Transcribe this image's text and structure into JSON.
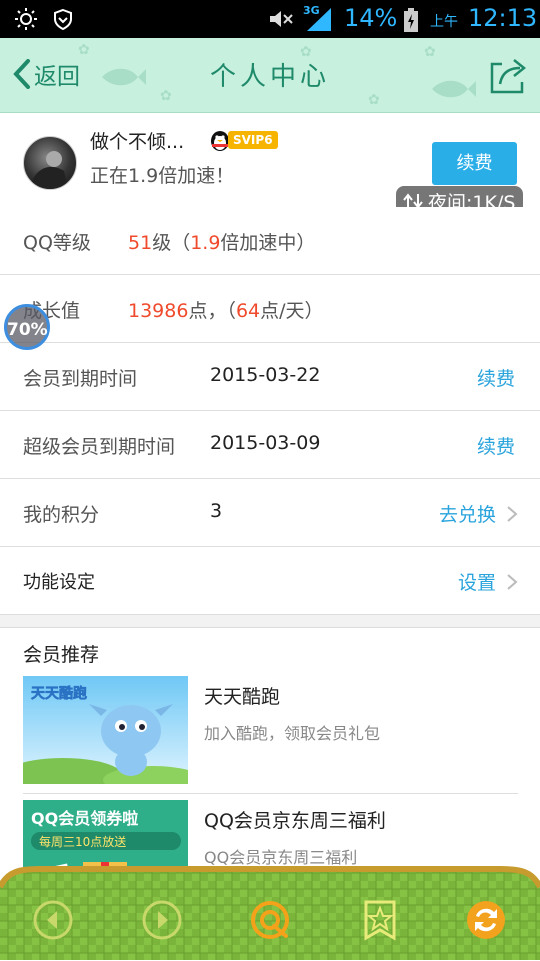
{
  "status_bar": {
    "network": "3G",
    "battery": "14%",
    "ampm": "上午",
    "time": "12:13"
  },
  "header": {
    "back_label": "返回",
    "title": "个人中心"
  },
  "profile": {
    "nickname": "做个不倾...",
    "vip_badge": "SVIP6",
    "speed_text": "正在1.9倍加速！",
    "renew_label": "续费",
    "speed_float": "夜间:1K/S"
  },
  "rows": [
    {
      "label": "QQ等级",
      "value_number": "51",
      "value_rest": "级（",
      "value_number2": "1.9",
      "value_tail": "倍加速中）"
    },
    {
      "label": "成长值",
      "value_number": "13986",
      "value_rest": "点，（",
      "value_number2": "64",
      "value_tail": "点/天）"
    },
    {
      "label": "会员到期时间",
      "value": "2015-03-22",
      "action": "续费"
    },
    {
      "label": "超级会员到期时间",
      "value": "2015-03-09",
      "action": "续费"
    },
    {
      "label": "我的积分",
      "value": "3",
      "action": "去兑换"
    },
    {
      "label": "功能设定",
      "action": "设置"
    }
  ],
  "float_badge": "70%",
  "recommend": {
    "title": "会员推荐",
    "items": [
      {
        "name": "天天酷跑",
        "desc": "加入酷跑，领取会员礼包",
        "banner_text": "天天酷跑"
      },
      {
        "name": "QQ会员京东周三福利",
        "desc": "QQ会员京东周三福利",
        "banner_text": "QQ会员领券啦",
        "banner_sub": "每周三10点放送"
      }
    ]
  },
  "colors": {
    "accent": "#2aaee8",
    "highlight": "#f04a2c",
    "header_bg": "#c8f0de",
    "bottom_bar": "#7cb83c"
  },
  "toolbar_icons": [
    "back-arrow-icon",
    "forward-arrow-icon",
    "qq-browser-icon",
    "bookmark-star-icon",
    "refresh-icon"
  ]
}
